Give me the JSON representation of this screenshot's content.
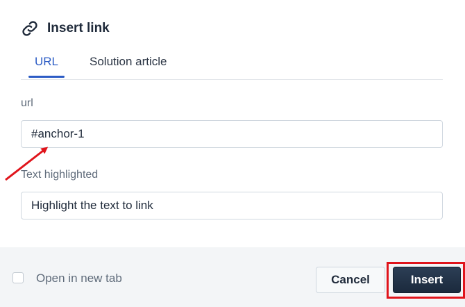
{
  "dialog": {
    "title": "Insert link",
    "title_icon": "link-icon"
  },
  "tabs": [
    {
      "label": "URL",
      "active": true
    },
    {
      "label": "Solution article",
      "active": false
    }
  ],
  "url_field": {
    "label": "url",
    "value": "#anchor-1"
  },
  "text_field": {
    "label": "Text highlighted",
    "value": "Highlight the text to link"
  },
  "footer": {
    "open_new_tab_label": "Open in new tab",
    "open_new_tab_checked": false,
    "cancel_label": "Cancel",
    "insert_label": "Insert"
  },
  "colors": {
    "accent": "#2c5cc5",
    "primary_button": "#1f3046",
    "annotation": "#e0141b",
    "footer_bg": "#f3f5f7"
  }
}
